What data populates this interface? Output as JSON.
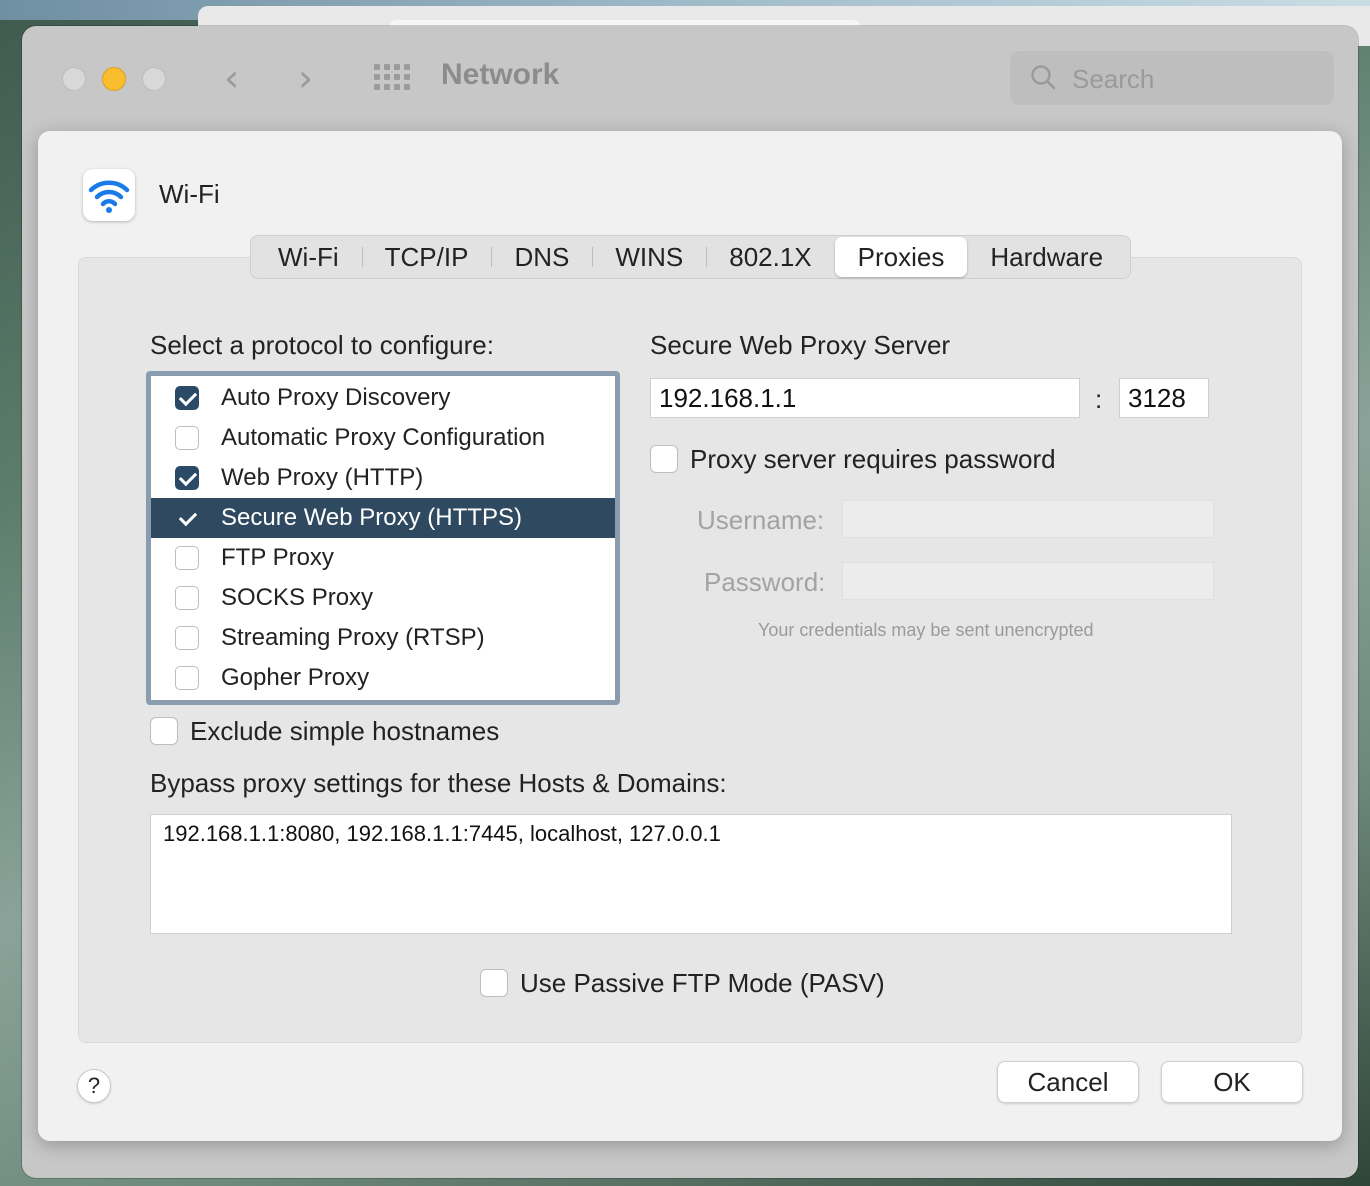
{
  "window": {
    "title": "Network",
    "search_placeholder": "Search",
    "accent_color": "#f9bd2e"
  },
  "sheet": {
    "interface_name": "Wi-Fi",
    "interface_icon": "wifi-icon",
    "tabs": [
      {
        "label": "Wi-Fi",
        "selected": false
      },
      {
        "label": "TCP/IP",
        "selected": false
      },
      {
        "label": "DNS",
        "selected": false
      },
      {
        "label": "WINS",
        "selected": false
      },
      {
        "label": "802.1X",
        "selected": false
      },
      {
        "label": "Proxies",
        "selected": true
      },
      {
        "label": "Hardware",
        "selected": false
      }
    ]
  },
  "proxies": {
    "protocol_heading": "Select a protocol to configure:",
    "protocols": [
      {
        "label": "Auto Proxy Discovery",
        "checked": true,
        "selected": false
      },
      {
        "label": "Automatic Proxy Configuration",
        "checked": false,
        "selected": false
      },
      {
        "label": "Web Proxy (HTTP)",
        "checked": true,
        "selected": false
      },
      {
        "label": "Secure Web Proxy (HTTPS)",
        "checked": true,
        "selected": true
      },
      {
        "label": "FTP Proxy",
        "checked": false,
        "selected": false
      },
      {
        "label": "SOCKS Proxy",
        "checked": false,
        "selected": false
      },
      {
        "label": "Streaming Proxy (RTSP)",
        "checked": false,
        "selected": false
      },
      {
        "label": "Gopher Proxy",
        "checked": false,
        "selected": false
      }
    ],
    "server_heading": "Secure Web Proxy Server",
    "server_address": "192.168.1.1",
    "port_separator": ":",
    "server_port": "3128",
    "requires_password_label": "Proxy server requires password",
    "requires_password_checked": false,
    "username_label": "Username:",
    "username_value": "",
    "password_label": "Password:",
    "password_value": "",
    "credentials_hint": "Your credentials may be sent unencrypted",
    "exclude_simple_label": "Exclude simple hostnames",
    "exclude_simple_checked": false,
    "bypass_heading": "Bypass proxy settings for these Hosts & Domains:",
    "bypass_value": "192.168.1.1:8080, 192.168.1.1:7445, localhost, 127.0.0.1",
    "pasv_label": "Use Passive FTP Mode (PASV)",
    "pasv_checked": false
  },
  "buttons": {
    "help": "?",
    "cancel": "Cancel",
    "ok": "OK"
  }
}
